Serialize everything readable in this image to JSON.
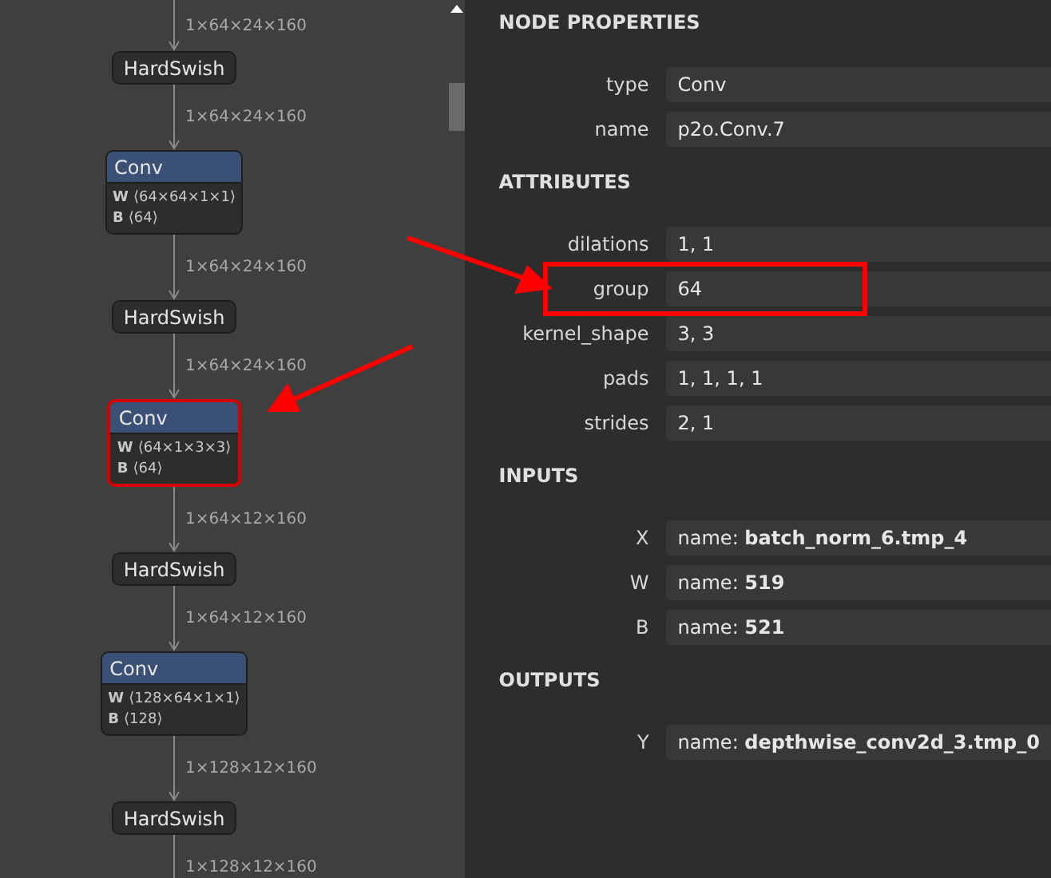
{
  "graph": {
    "items": [
      {
        "kind": "edge",
        "label": "1×64×24×160"
      },
      {
        "kind": "node",
        "type": "HardSwish",
        "selected": false
      },
      {
        "kind": "edge",
        "label": "1×64×24×160"
      },
      {
        "kind": "node",
        "type": "Conv",
        "selected": false,
        "params": [
          {
            "name": "W",
            "shape": "⟨64×64×1×1⟩"
          },
          {
            "name": "B",
            "shape": "⟨64⟩"
          }
        ]
      },
      {
        "kind": "edge",
        "label": "1×64×24×160"
      },
      {
        "kind": "node",
        "type": "HardSwish",
        "selected": false
      },
      {
        "kind": "edge",
        "label": "1×64×24×160"
      },
      {
        "kind": "node",
        "type": "Conv",
        "selected": true,
        "params": [
          {
            "name": "W",
            "shape": "⟨64×1×3×3⟩"
          },
          {
            "name": "B",
            "shape": "⟨64⟩"
          }
        ]
      },
      {
        "kind": "edge",
        "label": "1×64×12×160"
      },
      {
        "kind": "node",
        "type": "HardSwish",
        "selected": false
      },
      {
        "kind": "edge",
        "label": "1×64×12×160"
      },
      {
        "kind": "node",
        "type": "Conv",
        "selected": false,
        "params": [
          {
            "name": "W",
            "shape": "⟨128×64×1×1⟩"
          },
          {
            "name": "B",
            "shape": "⟨128⟩"
          }
        ]
      },
      {
        "kind": "edge",
        "label": "1×128×12×160"
      },
      {
        "kind": "node",
        "type": "HardSwish",
        "selected": false
      },
      {
        "kind": "edge",
        "label": "1×128×12×160"
      }
    ]
  },
  "properties": {
    "sections": [
      {
        "title": "NODE PROPERTIES",
        "rows": [
          {
            "label": "type",
            "value": "Conv",
            "highlighted": false
          },
          {
            "label": "name",
            "value": "p2o.Conv.7",
            "highlighted": false
          }
        ]
      },
      {
        "title": "ATTRIBUTES",
        "rows": [
          {
            "label": "dilations",
            "value": "1, 1",
            "highlighted": false
          },
          {
            "label": "group",
            "value": "64",
            "highlighted": true
          },
          {
            "label": "kernel_shape",
            "value": "3, 3",
            "highlighted": false
          },
          {
            "label": "pads",
            "value": "1, 1, 1, 1",
            "highlighted": false
          },
          {
            "label": "strides",
            "value": "2, 1",
            "highlighted": false
          }
        ]
      },
      {
        "title": "INPUTS",
        "rows": [
          {
            "label": "X",
            "value": "name: **batch_norm_6.tmp_4**",
            "highlighted": false
          },
          {
            "label": "W",
            "value": "name: **519**",
            "highlighted": false
          },
          {
            "label": "B",
            "value": "name: **521**",
            "highlighted": false
          }
        ]
      },
      {
        "title": "OUTPUTS",
        "rows": [
          {
            "label": "Y",
            "value": "name: **depthwise_conv2d_3.tmp_0**",
            "highlighted": false
          }
        ]
      }
    ]
  }
}
